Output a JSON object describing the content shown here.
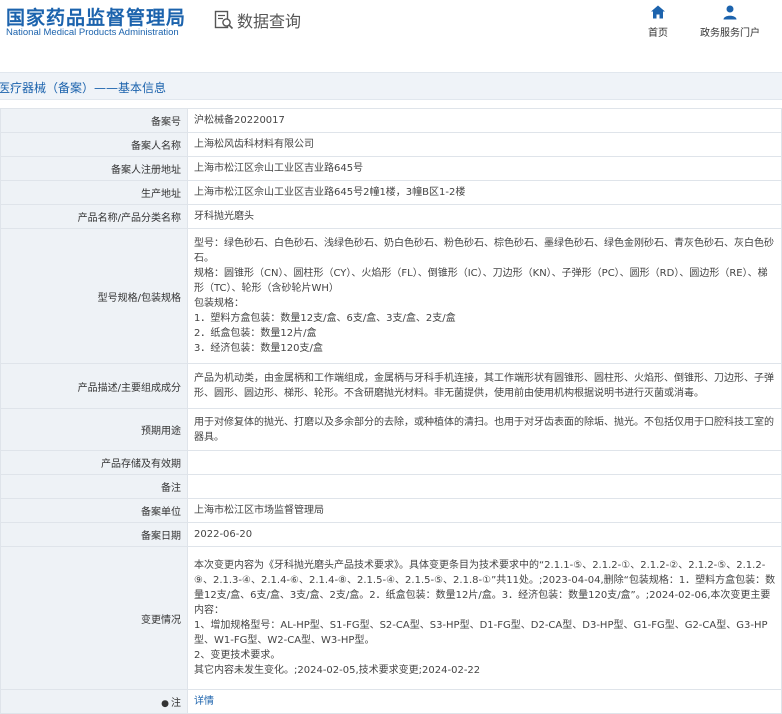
{
  "header": {
    "logo_cn": "国家药品监督管理局",
    "logo_en": "National Medical Products Administration",
    "query_label": "数据查询",
    "nav": [
      {
        "label": "首页",
        "icon": "home-icon"
      },
      {
        "label": "政务服务门户",
        "icon": "user-icon"
      }
    ]
  },
  "section": {
    "title": "医疗器械（备案）——基本信息"
  },
  "colors": {
    "brand": "#1c63ad",
    "label_bg": "#eef2f6",
    "section_bg": "#eff3f8",
    "border": "#dfe4ea"
  },
  "rows": [
    {
      "label": "备案号",
      "lines": [
        "沪松械备20220017"
      ]
    },
    {
      "label": "备案人名称",
      "lines": [
        "上海松风齿科材料有限公司"
      ]
    },
    {
      "label": "备案人注册地址",
      "lines": [
        "上海市松江区佘山工业区吉业路645号"
      ]
    },
    {
      "label": "生产地址",
      "lines": [
        "上海市松江区佘山工业区吉业路645号2幢1楼，3幢B区1-2楼"
      ]
    },
    {
      "label": "产品名称/产品分类名称",
      "lines": [
        "牙科抛光磨头"
      ]
    },
    {
      "label": "型号规格/包装规格",
      "lines": [
        "型号：绿色砂石、白色砂石、浅绿色砂石、奶白色砂石、粉色砂石、棕色砂石、墨绿色砂石、绿色金刚砂石、青灰色砂石、灰白色砂石。",
        "规格：圆锥形（CN）、圆柱形（CY）、火焰形（FL）、倒锥形（IC）、刀边形（KN）、子弹形（PC）、圆形（RD）、圆边形（RE）、梯形（TC）、轮形（含砂轮片WH）",
        "包装规格：",
        "1．塑料方盒包装：数量12支/盒、6支/盒、3支/盒、2支/盒",
        "2．纸盒包装：数量12片/盒",
        "3．经济包装：数量120支/盒"
      ]
    },
    {
      "label": "产品描述/主要组成成分",
      "lines": [
        "产品为机动类，由金属柄和工作端组成，金属柄与牙科手机连接，其工作端形状有圆锥形、圆柱形、火焰形、倒锥形、刀边形、子弹形、圆形、圆边形、梯形、轮形。不含研磨抛光材料。非无菌提供，使用前由使用机构根据说明书进行灭菌或消毒。"
      ]
    },
    {
      "label": "预期用途",
      "lines": [
        "用于对修复体的抛光、打磨以及多余部分的去除，或种植体的清扫。也用于对牙齿表面的除垢、抛光。不包括仅用于口腔科技工室的器具。"
      ]
    },
    {
      "label": "产品存储及有效期",
      "lines": [
        ""
      ]
    },
    {
      "label": "备注",
      "lines": [
        ""
      ]
    },
    {
      "label": "备案单位",
      "lines": [
        "上海市松江区市场监督管理局"
      ]
    },
    {
      "label": "备案日期",
      "lines": [
        "2022-06-20"
      ]
    },
    {
      "label": "变更情况",
      "lines": [
        "本次变更内容为《牙科抛光磨头产品技术要求》。具体变更条目为技术要求中的“2.1.1-⑤、2.1.2-①、2.1.2-②、2.1.2-⑤、2.1.2-⑨、2.1.3-④、2.1.4-⑥、2.1.4-⑧、2.1.5-④、2.1.5-⑤、2.1.8-①”共11处。;2023-04-04,删除“包装规格：1．塑料方盒包装：数量12支/盒、6支/盒、3支/盒、2支/盒。2．纸盒包装：数量12片/盒。3．经济包装：数量120支/盒”。;2024-02-06,本次变更主要内容：",
        "1、增加规格型号：AL-HP型、S1-FG型、S2-CA型、S3-HP型、D1-FG型、D2-CA型、D3-HP型、G1-FG型、G2-CA型、G3-HP型、W1-FG型、W2-CA型、W3-HP型。",
        "2、变更技术要求。",
        "其它内容未发生变化。;2024-02-05,技术要求变更;2024-02-22"
      ]
    }
  ],
  "note_row": {
    "label": "注",
    "link_text": "详情"
  }
}
